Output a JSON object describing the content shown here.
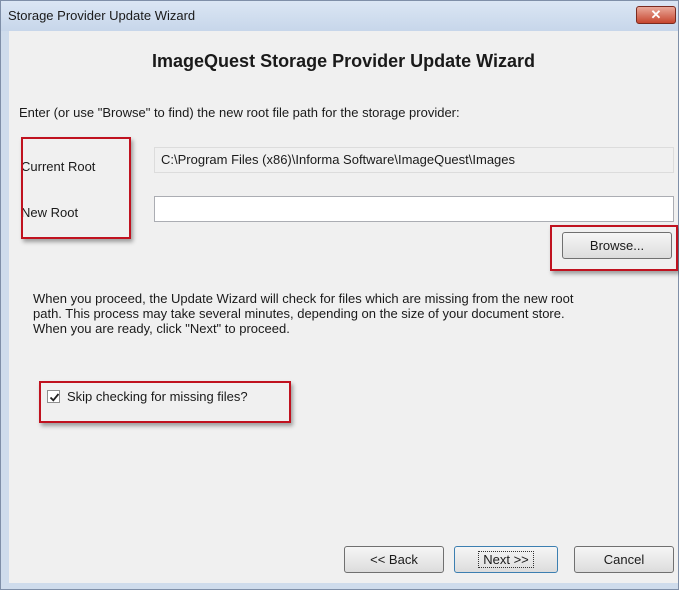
{
  "window": {
    "title": "Storage Provider Update Wizard",
    "close_glyph": "✕"
  },
  "wizard": {
    "heading": "ImageQuest Storage Provider Update Wizard",
    "instruction": "Enter (or use \"Browse\" to find) the new root file path for the storage provider:",
    "current_root_label": "Current Root",
    "current_root_value": "C:\\Program Files (x86)\\Informa Software\\ImageQuest\\Images",
    "new_root_label": "New Root",
    "new_root_value": "",
    "browse_label": "Browse...",
    "description": "When you proceed, the Update Wizard will check for files which are missing from the new root path.  This process may take several minutes, depending on the size of your document store.   When you are ready, click \"Next\" to proceed.",
    "skip_check_label": "Skip checking for missing files?",
    "skip_check_checked": true
  },
  "buttons": {
    "back": "<< Back",
    "next": "Next >>",
    "cancel": "Cancel"
  },
  "colors": {
    "highlight": "#c0121f",
    "titlebar": "#c7d6ea",
    "close": "#c7462f"
  }
}
